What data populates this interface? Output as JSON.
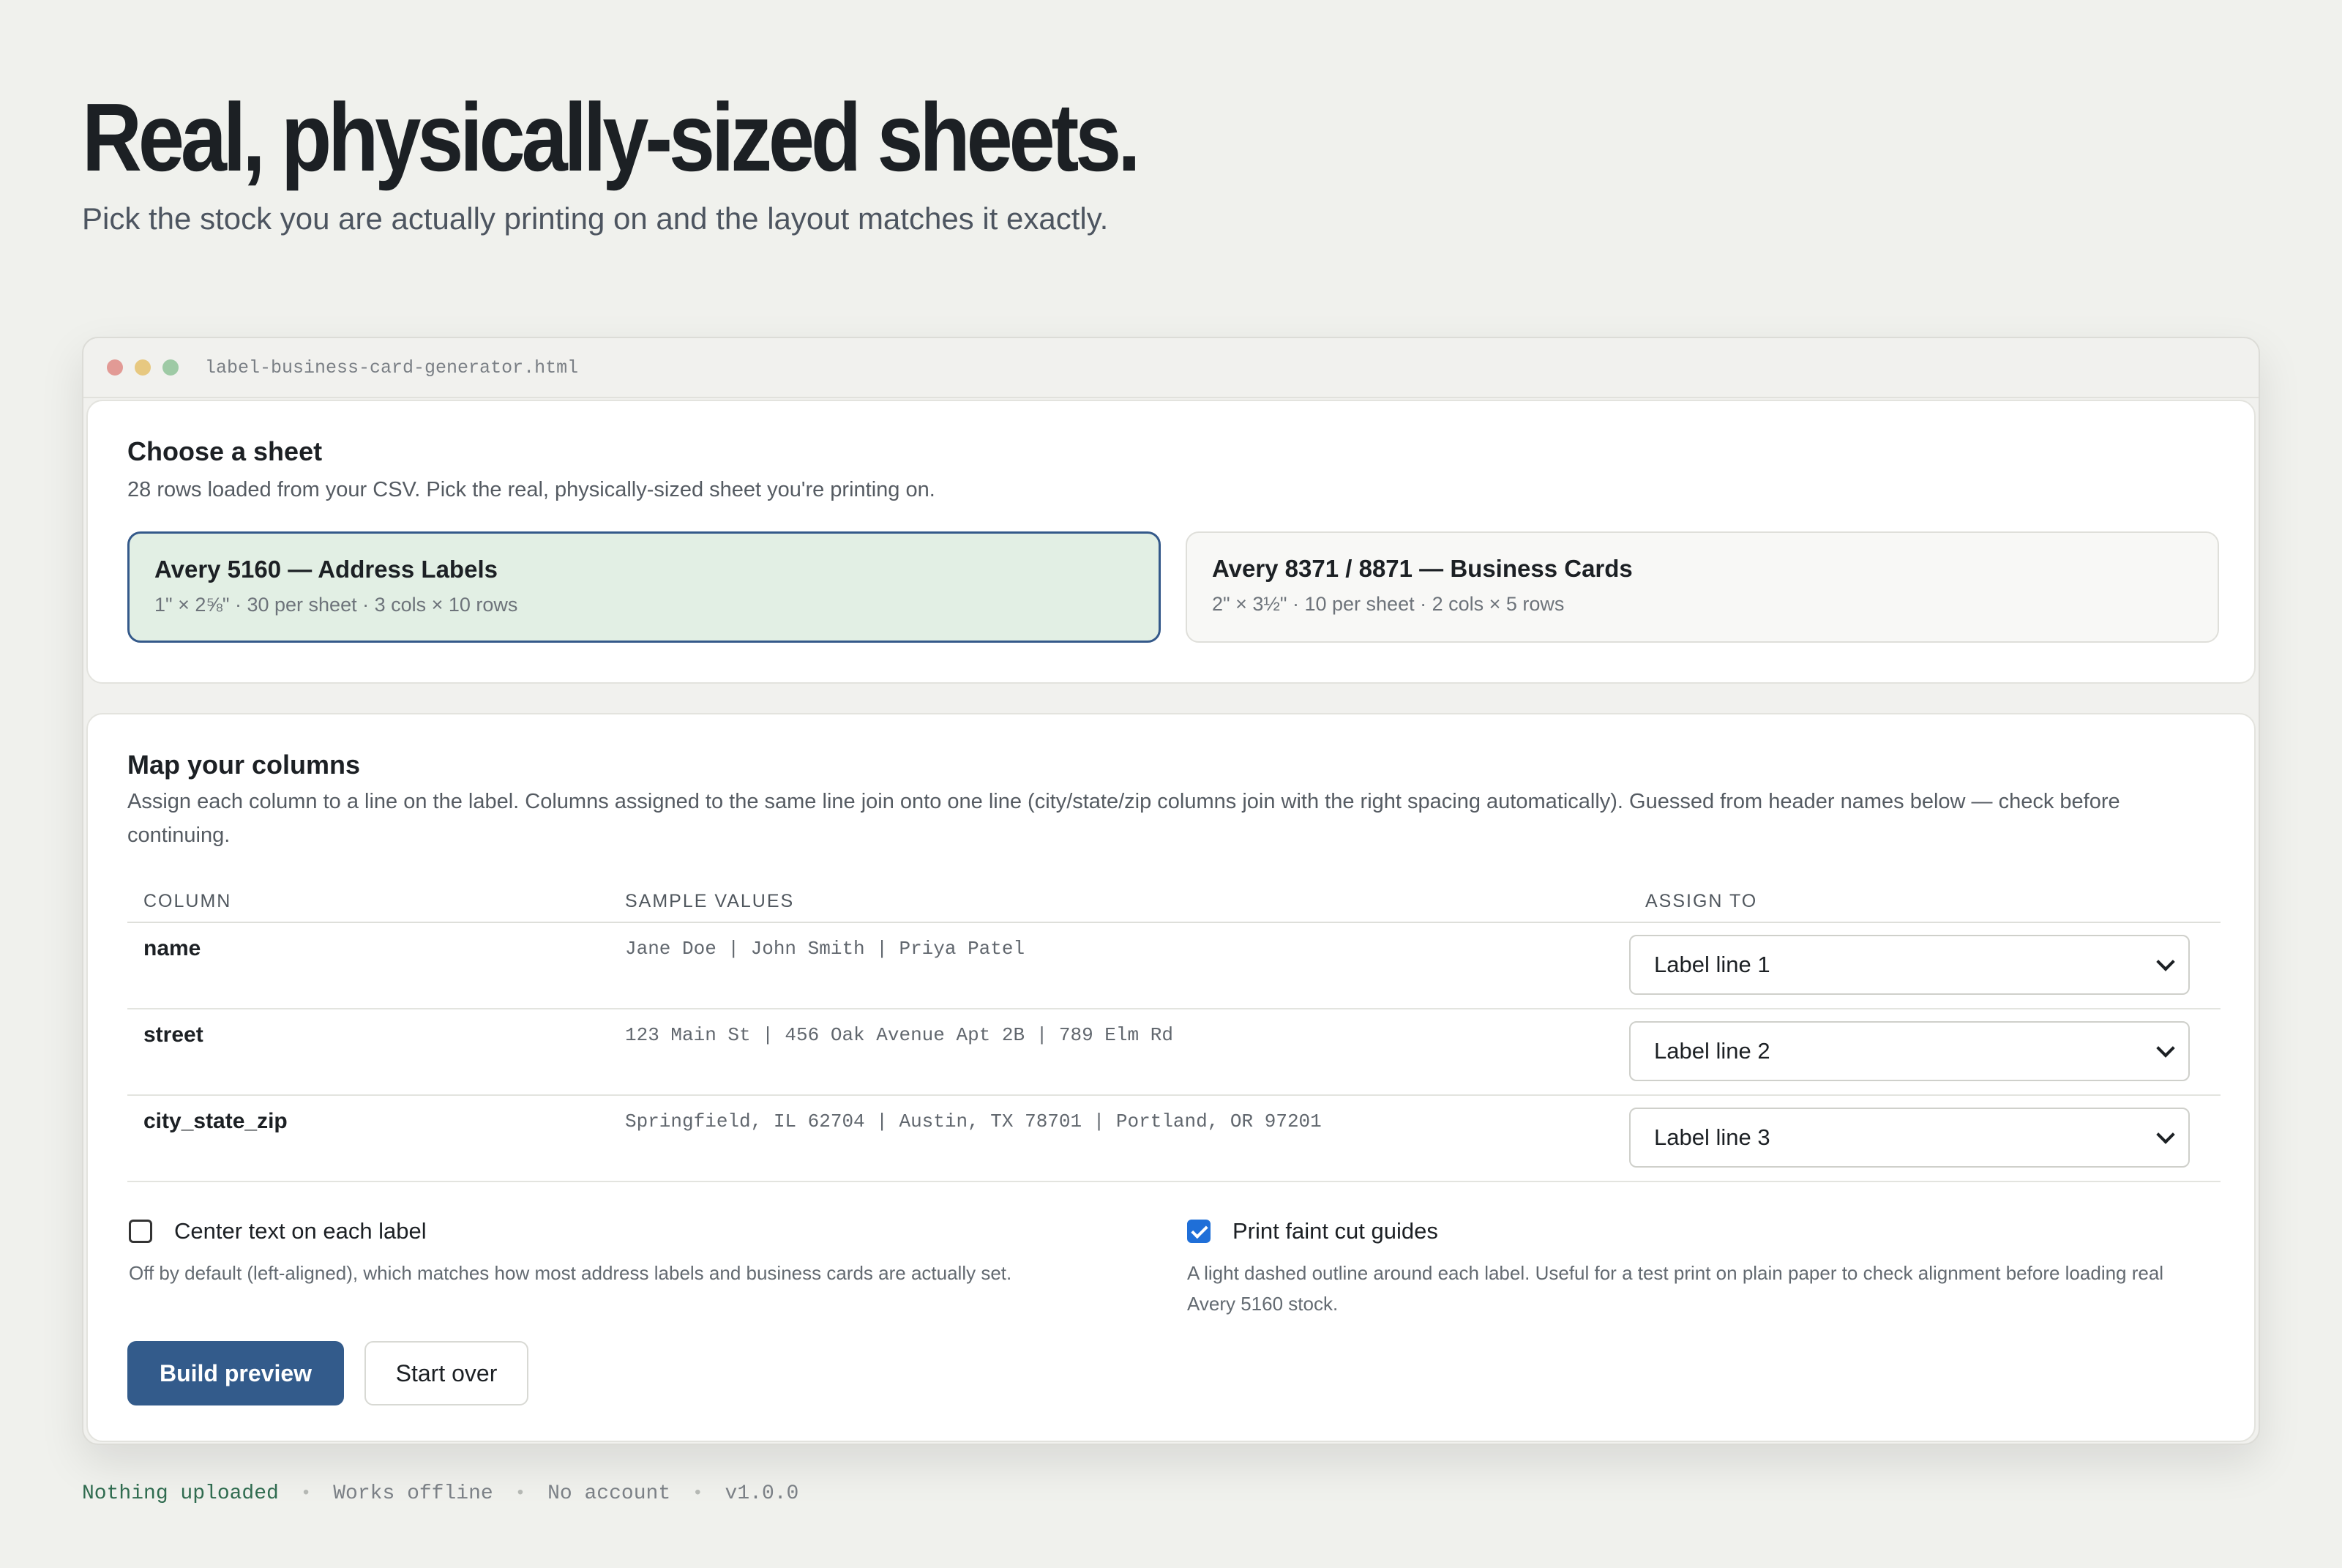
{
  "hero": {
    "title": "Real, physically-sized sheets.",
    "subtitle": "Pick the stock you are actually printing on and the layout matches it exactly."
  },
  "window": {
    "filename": "label-business-card-generator.html"
  },
  "choose_sheet": {
    "title": "Choose a sheet",
    "description": "28 rows loaded from your CSV. Pick the real, physically-sized sheet you're printing on.",
    "options": [
      {
        "title": "Avery 5160 — Address Labels",
        "spec": "1\" × 2⅝\" · 30 per sheet · 3 cols × 10 rows",
        "selected": true
      },
      {
        "title": "Avery 8371 / 8871 — Business Cards",
        "spec": "2\" × 3½\" · 10 per sheet · 2 cols × 5 rows",
        "selected": false
      }
    ]
  },
  "map_columns": {
    "title": "Map your columns",
    "description": "Assign each column to a line on the label. Columns assigned to the same line join onto one line (city/state/zip columns join with the right spacing automatically). Guessed from header names below — check before continuing.",
    "headers": [
      "COLUMN",
      "SAMPLE VALUES",
      "ASSIGN TO"
    ],
    "rows": [
      {
        "column": "name",
        "samples": "Jane Doe | John Smith | Priya Patel",
        "assign": "Label line 1"
      },
      {
        "column": "street",
        "samples": "123 Main St | 456 Oak Avenue Apt 2B | 789 Elm Rd",
        "assign": "Label line 2"
      },
      {
        "column": "city_state_zip",
        "samples": "Springfield, IL 62704 | Austin, TX 78701 | Portland, OR 97201",
        "assign": "Label line 3"
      }
    ]
  },
  "options": {
    "center": {
      "label": "Center text on each label",
      "checked": false,
      "help": "Off by default (left-aligned), which matches how most address labels and business cards are actually set."
    },
    "guides": {
      "label": "Print faint cut guides",
      "checked": true,
      "help": "A light dashed outline around each label. Useful for a test print on plain paper to check alignment before loading real Avery 5160 stock."
    }
  },
  "actions": {
    "build": "Build preview",
    "reset": "Start over"
  },
  "footer": {
    "items": [
      "Nothing uploaded",
      "Works offline",
      "No account",
      "v1.0.0"
    ],
    "separator": "•"
  },
  "colors": {
    "accent": "#335b8b",
    "selected_bg": "#e2efe4",
    "footer_accent": "#2f6b4f"
  }
}
